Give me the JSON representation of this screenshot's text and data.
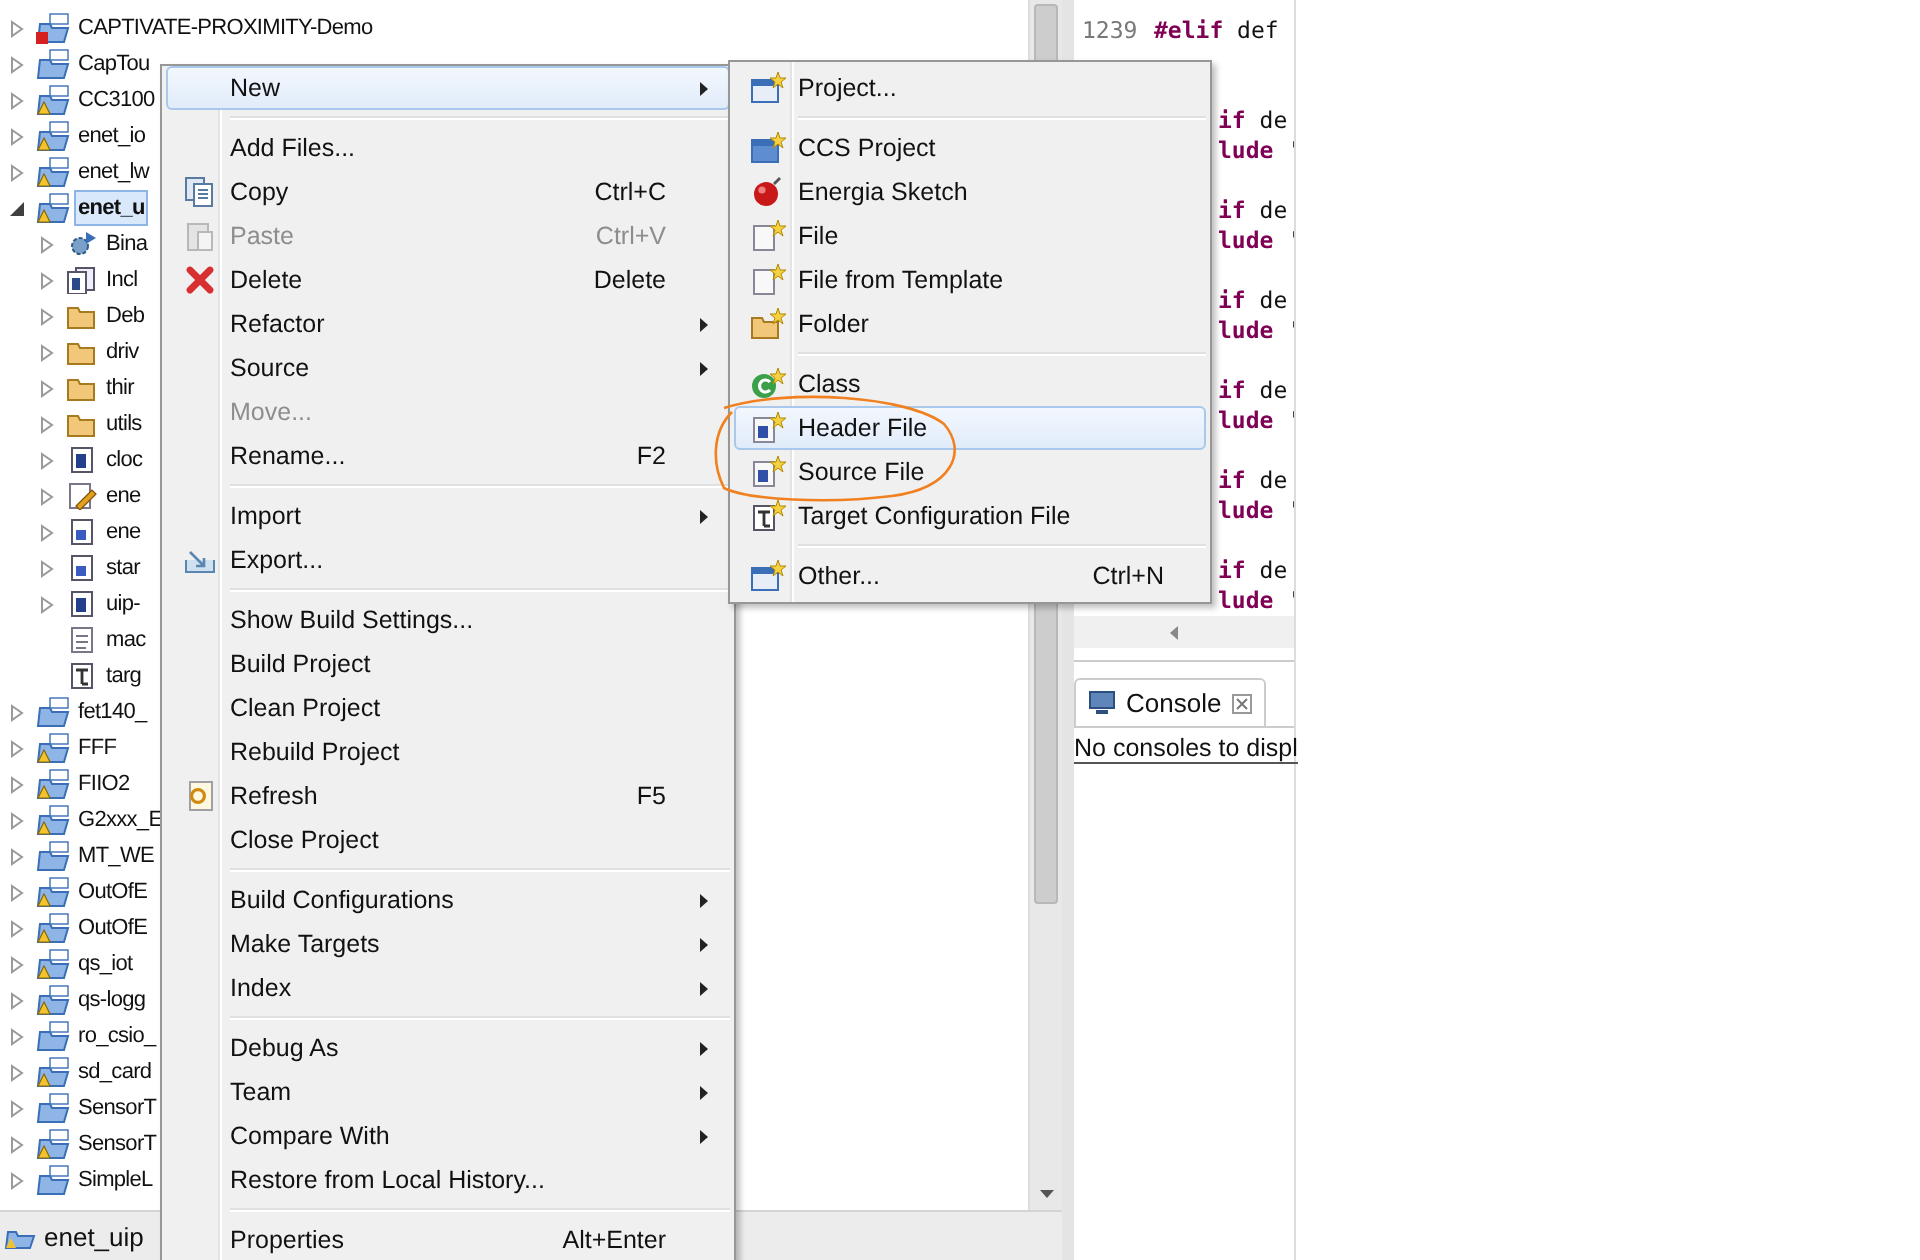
{
  "project_tree": [
    {
      "label": "CAPTIVATE-PROXIMITY-Demo",
      "warning": false,
      "error": true,
      "expanded": false,
      "selected": false
    },
    {
      "label": "CapTou",
      "warning": false,
      "error": false,
      "expanded": false,
      "selected": false
    },
    {
      "label": "CC3100",
      "warning": true,
      "error": false,
      "expanded": false,
      "selected": false
    },
    {
      "label": "enet_io",
      "warning": true,
      "error": false,
      "expanded": false,
      "selected": false
    },
    {
      "label": "enet_lw",
      "warning": true,
      "error": false,
      "expanded": false,
      "selected": false
    },
    {
      "label": "enet_u",
      "warning": true,
      "error": false,
      "expanded": true,
      "selected": true,
      "children": [
        {
          "label": "Bina",
          "kind": "binaries",
          "expanded": false
        },
        {
          "label": "Incl",
          "kind": "includes",
          "expanded": false
        },
        {
          "label": "Deb",
          "kind": "folder",
          "expanded": false
        },
        {
          "label": "driv",
          "kind": "folder",
          "expanded": false
        },
        {
          "label": "thir",
          "kind": "folder",
          "expanded": false
        },
        {
          "label": "utils",
          "kind": "folder",
          "expanded": false
        },
        {
          "label": "cloc",
          "kind": "h-file",
          "expanded": false
        },
        {
          "label": "ene",
          "kind": "linker-file",
          "expanded": false
        },
        {
          "label": "ene",
          "kind": "c-file",
          "expanded": false
        },
        {
          "label": "star",
          "kind": "c-file",
          "expanded": false
        },
        {
          "label": "uip-",
          "kind": "h-file",
          "expanded": false
        },
        {
          "label": "mac",
          "kind": "doc"
        },
        {
          "label": "targ",
          "kind": "target"
        }
      ]
    },
    {
      "label": "fet140_",
      "warning": false,
      "error": false,
      "expanded": false,
      "selected": false
    },
    {
      "label": "FFF",
      "warning": true,
      "error": false,
      "expanded": false,
      "selected": false
    },
    {
      "label": "FIIO2",
      "warning": true,
      "error": false,
      "expanded": false,
      "selected": false
    },
    {
      "label": "G2xxx_E",
      "warning": true,
      "error": false,
      "expanded": false,
      "selected": false
    },
    {
      "label": "MT_WE",
      "warning": false,
      "error": false,
      "expanded": false,
      "selected": false
    },
    {
      "label": "OutOfE",
      "warning": true,
      "error": false,
      "expanded": false,
      "selected": false
    },
    {
      "label": "OutOfE",
      "warning": true,
      "error": false,
      "expanded": false,
      "selected": false
    },
    {
      "label": "qs_iot",
      "warning": true,
      "error": false,
      "expanded": false,
      "selected": false
    },
    {
      "label": "qs-logg",
      "warning": true,
      "error": false,
      "expanded": false,
      "selected": false
    },
    {
      "label": "ro_csio_",
      "warning": false,
      "error": false,
      "expanded": false,
      "selected": false
    },
    {
      "label": "sd_card",
      "warning": true,
      "error": false,
      "expanded": false,
      "selected": false
    },
    {
      "label": "SensorT",
      "warning": false,
      "error": false,
      "expanded": false,
      "selected": false
    },
    {
      "label": "SensorT",
      "warning": true,
      "error": false,
      "expanded": false,
      "selected": false
    },
    {
      "label": "SimpleL",
      "warning": false,
      "error": false,
      "expanded": false,
      "selected": false
    }
  ],
  "status_bar": {
    "label": "enet_uip"
  },
  "editor": {
    "lines": [
      {
        "kind": "numbered",
        "number": "1239",
        "directive": "#elif",
        "rest": "def"
      },
      {
        "kind": "blank"
      },
      {
        "kind": "blank"
      },
      {
        "kind": "covered",
        "directive": "if",
        "rest": "de"
      },
      {
        "kind": "covered",
        "directive": "lude",
        "rest": "'"
      },
      {
        "kind": "blank"
      },
      {
        "kind": "covered",
        "directive": "if",
        "rest": "de"
      },
      {
        "kind": "covered",
        "directive": "lude",
        "rest": "'"
      },
      {
        "kind": "blank"
      },
      {
        "kind": "covered",
        "directive": "if",
        "rest": "de"
      },
      {
        "kind": "covered",
        "directive": "lude",
        "rest": "'"
      },
      {
        "kind": "blank"
      },
      {
        "kind": "covered",
        "directive": "if",
        "rest": "de"
      },
      {
        "kind": "covered",
        "directive": "lude",
        "rest": "'"
      },
      {
        "kind": "blank"
      },
      {
        "kind": "covered",
        "directive": "if",
        "rest": "de"
      },
      {
        "kind": "covered",
        "directive": "lude",
        "rest": "'"
      },
      {
        "kind": "blank"
      },
      {
        "kind": "covered",
        "directive": "if",
        "rest": "de"
      },
      {
        "kind": "covered",
        "directive": "lude",
        "rest": "'"
      }
    ]
  },
  "console": {
    "tab": "Console",
    "message": "No consoles to displ"
  },
  "context_menu": [
    {
      "kind": "plain",
      "label": "New",
      "submenu": true,
      "disabled": false,
      "selected": true
    },
    {
      "kind": "separator"
    },
    {
      "kind": "plain",
      "label": "Add Files...",
      "submenu": false,
      "disabled": false,
      "selected": false
    },
    {
      "kind": "copy",
      "label": "Copy",
      "shortcut": "Ctrl+C",
      "submenu": false,
      "disabled": false,
      "selected": false
    },
    {
      "kind": "paste",
      "label": "Paste",
      "shortcut": "Ctrl+V",
      "submenu": false,
      "disabled": true,
      "selected": false
    },
    {
      "kind": "delete",
      "label": "Delete",
      "shortcut": "Delete",
      "submenu": false,
      "disabled": false,
      "selected": false
    },
    {
      "kind": "plain",
      "label": "Refactor",
      "submenu": true,
      "disabled": false,
      "selected": false
    },
    {
      "kind": "plain",
      "label": "Source",
      "submenu": true,
      "disabled": false,
      "selected": false
    },
    {
      "kind": "plain",
      "label": "Move...",
      "submenu": false,
      "disabled": true,
      "selected": false
    },
    {
      "kind": "plain",
      "label": "Rename...",
      "shortcut": "F2",
      "submenu": false,
      "disabled": false,
      "selected": false
    },
    {
      "kind": "separator"
    },
    {
      "kind": "plain",
      "label": "Import",
      "submenu": true,
      "disabled": false,
      "selected": false
    },
    {
      "kind": "export",
      "label": "Export...",
      "submenu": false,
      "disabled": false,
      "selected": false
    },
    {
      "kind": "separator"
    },
    {
      "kind": "plain",
      "label": "Show Build Settings...",
      "submenu": false,
      "disabled": false,
      "selected": false
    },
    {
      "kind": "plain",
      "label": "Build Project",
      "submenu": false,
      "disabled": false,
      "selected": false
    },
    {
      "kind": "plain",
      "label": "Clean Project",
      "submenu": false,
      "disabled": false,
      "selected": false
    },
    {
      "kind": "plain",
      "label": "Rebuild Project",
      "submenu": false,
      "disabled": false,
      "selected": false
    },
    {
      "kind": "refresh",
      "label": "Refresh",
      "shortcut": "F5",
      "submenu": false,
      "disabled": false,
      "selected": false
    },
    {
      "kind": "plain",
      "label": "Close Project",
      "submenu": false,
      "disabled": false,
      "selected": false
    },
    {
      "kind": "separator"
    },
    {
      "kind": "plain",
      "label": "Build Configurations",
      "submenu": true,
      "disabled": false,
      "selected": false
    },
    {
      "kind": "plain",
      "label": "Make Targets",
      "submenu": true,
      "disabled": false,
      "selected": false
    },
    {
      "kind": "plain",
      "label": "Index",
      "submenu": true,
      "disabled": false,
      "selected": false
    },
    {
      "kind": "separator"
    },
    {
      "kind": "plain",
      "label": "Debug As",
      "submenu": true,
      "disabled": false,
      "selected": false
    },
    {
      "kind": "plain",
      "label": "Team",
      "submenu": true,
      "disabled": false,
      "selected": false
    },
    {
      "kind": "plain",
      "label": "Compare With",
      "submenu": true,
      "disabled": false,
      "selected": false
    },
    {
      "kind": "plain",
      "label": "Restore from Local History...",
      "submenu": false,
      "disabled": false,
      "selected": false
    },
    {
      "kind": "separator"
    },
    {
      "kind": "plain",
      "label": "Properties",
      "shortcut": "Alt+Enter",
      "submenu": false,
      "disabled": false,
      "selected": false
    }
  ],
  "new_submenu": [
    {
      "kind": "project",
      "label": "Project...",
      "selected": false
    },
    {
      "kind": "separator"
    },
    {
      "kind": "ccs-project",
      "label": "CCS Project",
      "selected": false
    },
    {
      "kind": "sketch",
      "label": "Energia Sketch",
      "selected": false
    },
    {
      "kind": "file",
      "label": "File",
      "selected": false
    },
    {
      "kind": "file",
      "label": "File from Template",
      "selected": false
    },
    {
      "kind": "folder",
      "label": "Folder",
      "selected": false
    },
    {
      "kind": "separator"
    },
    {
      "kind": "class",
      "label": "Class",
      "selected": false
    },
    {
      "kind": "header",
      "label": "Header File",
      "selected": true
    },
    {
      "kind": "source",
      "label": "Source File",
      "selected": false
    },
    {
      "kind": "target",
      "label": "Target Configuration File",
      "selected": false
    },
    {
      "kind": "separator"
    },
    {
      "kind": "project",
      "label": "Other...",
      "shortcut": "Ctrl+N",
      "selected": false
    }
  ]
}
